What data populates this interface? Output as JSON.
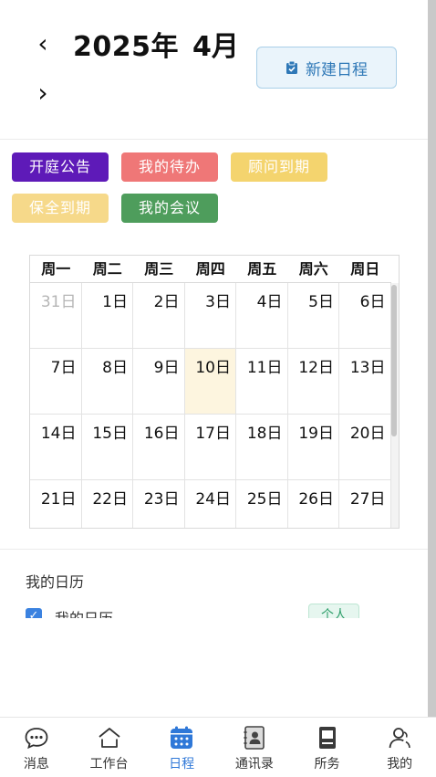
{
  "header": {
    "prev_icon": "chevron-left-icon",
    "next_icon": "chevron-right-icon",
    "year": "2025年",
    "month": "4月",
    "new_button": {
      "icon": "clipboard-check-icon",
      "label": "新建日程"
    }
  },
  "tags": [
    {
      "label": "开庭公告",
      "color": "#5e1ab8"
    },
    {
      "label": "我的待办",
      "color": "#ef7777"
    },
    {
      "label": "顾问到期",
      "color": "#f4d46e"
    },
    {
      "label": "保全到期",
      "color": "#f6d98a"
    },
    {
      "label": "我的会议",
      "color": "#4e9d5c"
    }
  ],
  "calendar": {
    "weekdays": [
      "周一",
      "周二",
      "周三",
      "周四",
      "周五",
      "周六",
      "周日"
    ],
    "weeks": [
      [
        "31日",
        "1日",
        "2日",
        "3日",
        "4日",
        "5日",
        "6日"
      ],
      [
        "7日",
        "8日",
        "9日",
        "10日",
        "11日",
        "12日",
        "13日"
      ],
      [
        "14日",
        "15日",
        "16日",
        "17日",
        "18日",
        "19日",
        "20日"
      ],
      [
        "21日",
        "22日",
        "23日",
        "24日",
        "25日",
        "26日",
        "27日"
      ]
    ],
    "muted_day": "31日",
    "today": "10日",
    "today_color": "#fdf5df"
  },
  "my_calendar": {
    "title": "我的日历",
    "item_label": "我的日历",
    "button_label": "个人"
  },
  "tabbar": {
    "active_color": "#2f78d8",
    "items": [
      {
        "label": "消息",
        "icon": "chat-bubble-icon"
      },
      {
        "label": "工作台",
        "icon": "home-icon"
      },
      {
        "label": "日程",
        "icon": "calendar-icon"
      },
      {
        "label": "通讯录",
        "icon": "contacts-book-icon"
      },
      {
        "label": "所务",
        "icon": "briefcase-icon"
      },
      {
        "label": "我的",
        "icon": "user-icon"
      }
    ]
  }
}
